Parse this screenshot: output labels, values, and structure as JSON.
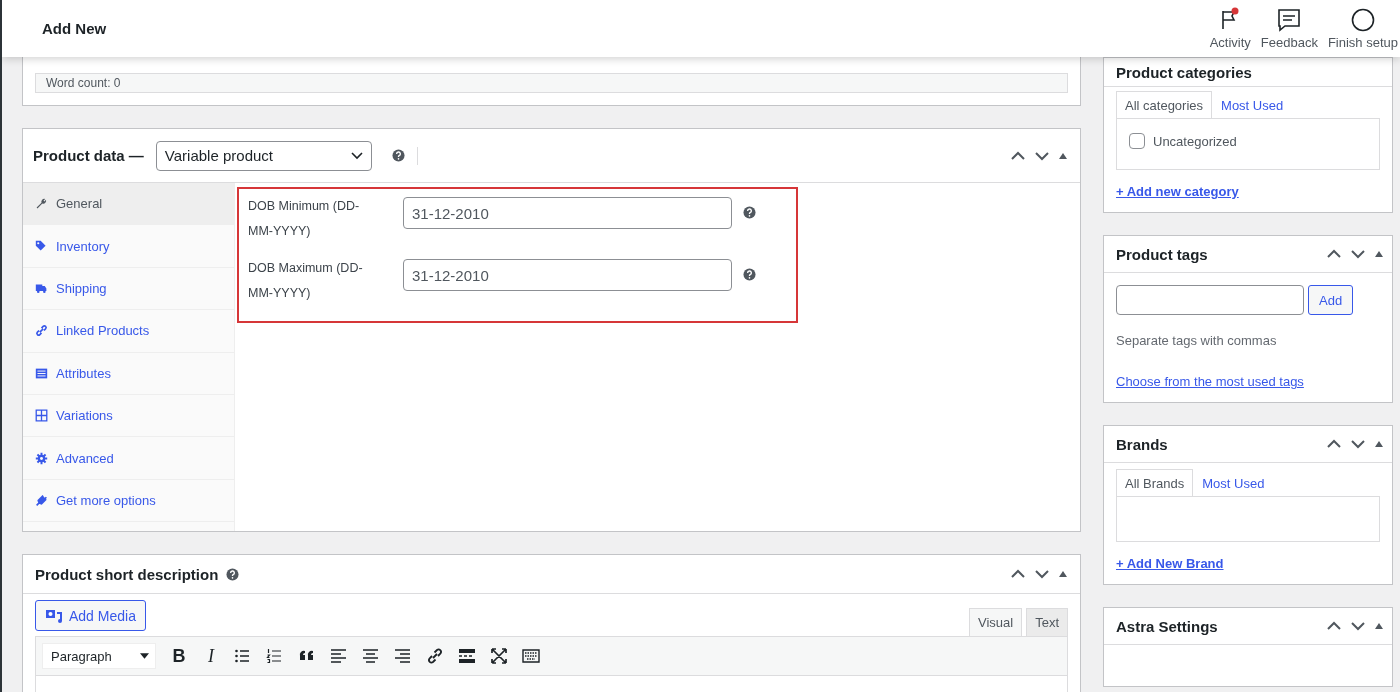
{
  "top_bar": {
    "title": "Add New",
    "actions": [
      {
        "kind": "activity",
        "label": "Activity",
        "notification": true
      },
      {
        "kind": "feedback",
        "label": "Feedback",
        "notification": false
      },
      {
        "kind": "finish",
        "label": "Finish setup",
        "notification": false
      }
    ]
  },
  "word_count": "Word count: 0",
  "product_data": {
    "title": "Product data —",
    "type": "Variable product",
    "highlighted": true,
    "tabs": [
      {
        "kind": "wrench",
        "label": "General",
        "selected": true
      },
      {
        "kind": "tag",
        "label": "Inventory",
        "selected": false
      },
      {
        "kind": "truck",
        "label": "Shipping",
        "selected": false
      },
      {
        "kind": "link",
        "label": "Linked Products",
        "selected": false
      },
      {
        "kind": "list",
        "label": "Attributes",
        "selected": false
      },
      {
        "kind": "grid",
        "label": "Variations",
        "selected": false
      },
      {
        "kind": "gear",
        "label": "Advanced",
        "selected": false
      },
      {
        "kind": "plugin",
        "label": "Get more options",
        "selected": false
      }
    ],
    "fields": [
      {
        "label": "DOB Minimum (DD-MM-YYYY)",
        "value": "31-12-2010"
      },
      {
        "label": "DOB Maximum (DD-MM-YYYY)",
        "value": "31-12-2010"
      }
    ]
  },
  "short_description": {
    "title": "Product short description",
    "add_media": "Add Media",
    "modes": [
      {
        "label": "Visual",
        "selected": true
      },
      {
        "label": "Text",
        "selected": false
      }
    ],
    "format": "Paragraph",
    "toolbar": [
      {
        "kind": "bold",
        "label": "B"
      },
      {
        "kind": "italic",
        "label": "I"
      },
      {
        "kind": "bullets"
      },
      {
        "kind": "numbers"
      },
      {
        "kind": "quote"
      },
      {
        "kind": "align-left"
      },
      {
        "kind": "align-center"
      },
      {
        "kind": "align-right"
      },
      {
        "kind": "link"
      },
      {
        "kind": "more"
      },
      {
        "kind": "fullscreen"
      },
      {
        "kind": "keyboard"
      }
    ]
  },
  "sidebar": {
    "categories": {
      "title": "Product categories",
      "tabs": [
        {
          "label": "All categories",
          "selected": true
        },
        {
          "label": "Most Used",
          "selected": false
        }
      ],
      "items": [
        {
          "label": "Uncategorized",
          "checked": false
        }
      ],
      "link": "+ Add new category"
    },
    "tags": {
      "title": "Product tags",
      "button": "Add",
      "hint": "Separate tags with commas",
      "link": "Choose from the most used tags"
    },
    "brands": {
      "title": "Brands",
      "tabs": [
        {
          "label": "All Brands",
          "selected": true
        },
        {
          "label": "Most Used",
          "selected": false
        }
      ],
      "link": "+ Add New Brand"
    },
    "astra": {
      "title": "Astra Settings"
    }
  }
}
